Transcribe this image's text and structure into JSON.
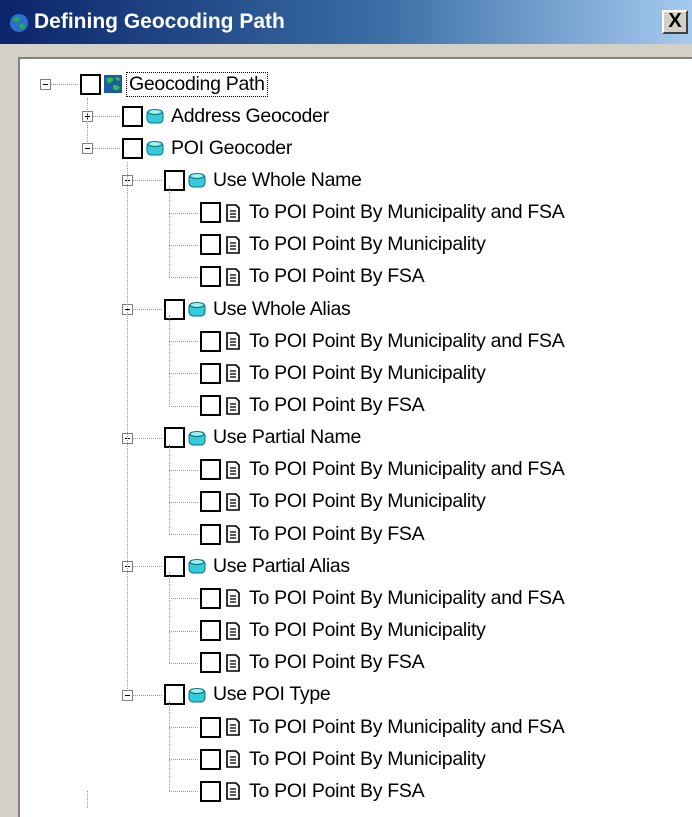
{
  "window": {
    "title": "Defining Geocoding Path",
    "close_label": "X"
  },
  "icons": {
    "title": "globe-icon",
    "close": "close-icon",
    "root": "globe-icon",
    "geocoder": "database-icon",
    "method": "database-icon",
    "rule": "document-icon"
  },
  "tree": {
    "root": "Geocoding Path",
    "geocoders": [
      {
        "label": "Address Geocoder",
        "expanded": false,
        "checked": false,
        "groups": []
      },
      {
        "label": "POI Geocoder",
        "expanded": true,
        "checked": false,
        "groups": [
          {
            "label": "Use Whole Name",
            "checked": false,
            "items": [
              "To POI Point By Municipality and FSA",
              "To POI Point By Municipality",
              "To POI Point By FSA"
            ]
          },
          {
            "label": "Use Whole Alias",
            "checked": false,
            "items": [
              "To POI Point By Municipality and FSA",
              "To POI Point By Municipality",
              "To POI Point By FSA"
            ]
          },
          {
            "label": "Use Partial Name",
            "checked": false,
            "items": [
              "To POI Point By Municipality and FSA",
              "To POI Point By Municipality",
              "To POI Point By FSA"
            ]
          },
          {
            "label": "Use Partial Alias",
            "checked": false,
            "items": [
              "To POI Point By Municipality and FSA",
              "To POI Point By Municipality",
              "To POI Point By FSA"
            ]
          },
          {
            "label": "Use POI Type",
            "checked": false,
            "items": [
              "To POI Point By Municipality and FSA",
              "To POI Point By Municipality",
              "To POI Point By FSA"
            ]
          }
        ]
      }
    ]
  },
  "colors": {
    "title_bar_start": "#0a246a",
    "title_bar_end": "#a6caf0",
    "tree_background": "#ffffff",
    "database_icon": "#33ccdd"
  }
}
